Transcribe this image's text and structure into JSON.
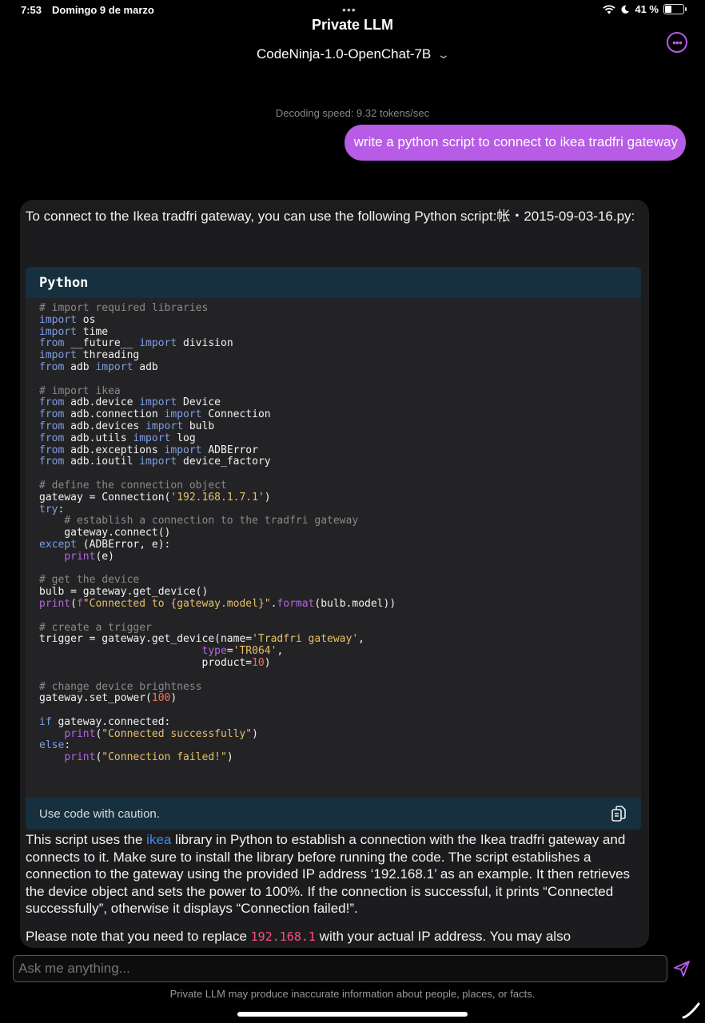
{
  "status_bar": {
    "time": "7:53",
    "date": "Domingo 9 de marzo",
    "battery": "41 %",
    "battery_level": 0.41
  },
  "header": {
    "app_title": "Private LLM",
    "model_name": "CodeNinja-1.0-OpenChat-7B"
  },
  "chat": {
    "decoding_speed": "Decoding speed: 9.32 tokens/sec",
    "user_message": "write a python script to connect to ikea tradfri gateway",
    "assistant": {
      "intro": "To connect to the Ikea tradfri gateway, you can use the following Python script:帐・2015-09-03-16.py:",
      "code_language": "Python",
      "code_caution": "Use code with caution.",
      "code": "# import required libraries\nimport os\nimport time\nfrom __future__ import division\nimport threading\nfrom adb import adb\n\n# import ikea\nfrom adb.device import Device\nfrom adb.connection import Connection\nfrom adb.devices import bulb\nfrom adb.utils import log\nfrom adb.exceptions import ADBError\nfrom adb.ioutil import device_factory\n\n# define the connection object\ngateway = Connection('192.168.1.7.1')\ntry:\n    # establish a connection to the tradfri gateway\n    gateway.connect()\nexcept (ADBError, e):\n    print(e)\n\n# get the device\nbulb = gateway.get_device()\nprint(f\"Connected to {gateway.model}\".format(bulb.model))\n\n# create a trigger\ntrigger = gateway.get_device(name='Tradfri gateway',\n                          type='TR064',\n                          product=10)\n\n# change device brightness\ngateway.set_power(100)\n\nif gateway.connected:\n    print(\"Connected successfully\")\nelse:\n    print(\"Connection failed!\")",
      "explanation_before_link": "This script uses the ",
      "explanation_link": "ikea",
      "explanation_after_link": " library in Python to establish a connection with the Ikea tradfri gateway and connects to it. Make sure to install the library before running the code. The script establishes a connection to the gateway using the provided IP address ‘192.168.1’ as an example. It then retrieves the device object and sets the power to 100%. If the connection is successful, it prints “Connected successfully”, otherwise it displays “Connection failed!”.",
      "note_before_code": "Please note that you need to replace ",
      "note_code": "192.168.1",
      "note_after_code": " with your actual IP address. You may also"
    }
  },
  "composer": {
    "placeholder": "Ask me anything...",
    "disclaimer": "Private LLM may produce inaccurate information about people, places, or facts."
  },
  "icons": {
    "wifi": "wifi-icon",
    "moon": "moon-icon",
    "battery": "battery-icon",
    "more": "more-icon",
    "chevron": "chevron-down-icon",
    "copy": "copy-icon",
    "send": "send-icon",
    "pencil": "pencil-icon"
  },
  "colors": {
    "accent": "#b75ce6",
    "code_header": "#16303f",
    "link": "#3c8bf2",
    "inline_code": "#ff4d7e"
  }
}
